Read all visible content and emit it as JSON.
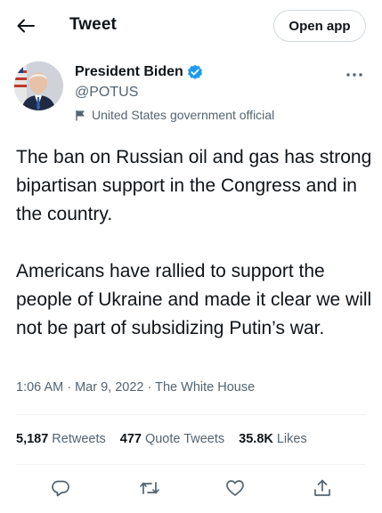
{
  "header": {
    "title": "Tweet",
    "open_app_label": "Open app"
  },
  "author": {
    "name": "President Biden",
    "handle": "@POTUS",
    "label": "United States government official"
  },
  "tweet": {
    "paragraphs": [
      "The ban on Russian oil and gas has strong bipartisan support in the Congress and in the country.",
      "Americans have rallied to support the people of Ukraine and made it clear we will not be part of subsidizing Putin’s war."
    ],
    "time": "1:06 AM",
    "date": "Mar 9, 2022",
    "source": "The White House"
  },
  "stats": {
    "retweets_count": "5,187",
    "retweets_label": "Retweets",
    "quotes_count": "477",
    "quotes_label": "Quote Tweets",
    "likes_count": "35.8K",
    "likes_label": "Likes"
  },
  "icons": {
    "back": "arrow-left-icon",
    "verified": "verified-badge-icon",
    "more": "more-dots-icon",
    "label": "flag-icon",
    "reply": "reply-icon",
    "retweet": "retweet-icon",
    "like": "heart-icon",
    "share": "share-icon"
  },
  "colors": {
    "verified": "#1d9bf0",
    "secondary_text": "#536471",
    "primary_text": "#0f1419"
  }
}
